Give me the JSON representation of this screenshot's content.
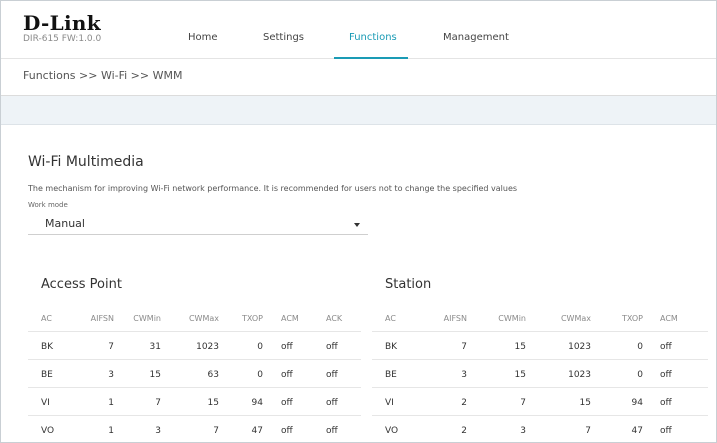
{
  "header": {
    "brand": "D-Link",
    "model": "DIR-615 FW:1.0.0",
    "nav": [
      {
        "label": "Home",
        "active": false
      },
      {
        "label": "Settings",
        "active": false
      },
      {
        "label": "Functions",
        "active": true
      },
      {
        "label": "Management",
        "active": false
      }
    ]
  },
  "breadcrumb": "Functions >> Wi-Fi >> WMM",
  "main": {
    "title": "Wi-Fi Multimedia",
    "description": "The mechanism for improving Wi-Fi network performance. It is recommended for users not to change the specified values",
    "work_mode": {
      "label": "Work mode",
      "value": "Manual"
    }
  },
  "access_point": {
    "title": "Access Point",
    "columns": [
      "AC",
      "AIFSN",
      "CWMin",
      "CWMax",
      "TXOP",
      "ACM",
      "ACK"
    ],
    "rows": [
      [
        "BK",
        "7",
        "31",
        "1023",
        "0",
        "off",
        "off"
      ],
      [
        "BE",
        "3",
        "15",
        "63",
        "0",
        "off",
        "off"
      ],
      [
        "VI",
        "1",
        "7",
        "15",
        "94",
        "off",
        "off"
      ],
      [
        "VO",
        "1",
        "3",
        "7",
        "47",
        "off",
        "off"
      ]
    ]
  },
  "station": {
    "title": "Station",
    "columns": [
      "AC",
      "AIFSN",
      "CWMin",
      "CWMax",
      "TXOP",
      "ACM"
    ],
    "rows": [
      [
        "BK",
        "7",
        "15",
        "1023",
        "0",
        "off"
      ],
      [
        "BE",
        "3",
        "15",
        "1023",
        "0",
        "off"
      ],
      [
        "VI",
        "2",
        "7",
        "15",
        "94",
        "off"
      ],
      [
        "VO",
        "2",
        "3",
        "7",
        "47",
        "off"
      ]
    ]
  },
  "colors": {
    "accent": "#1a9bb5",
    "band": "#eef3f7"
  }
}
